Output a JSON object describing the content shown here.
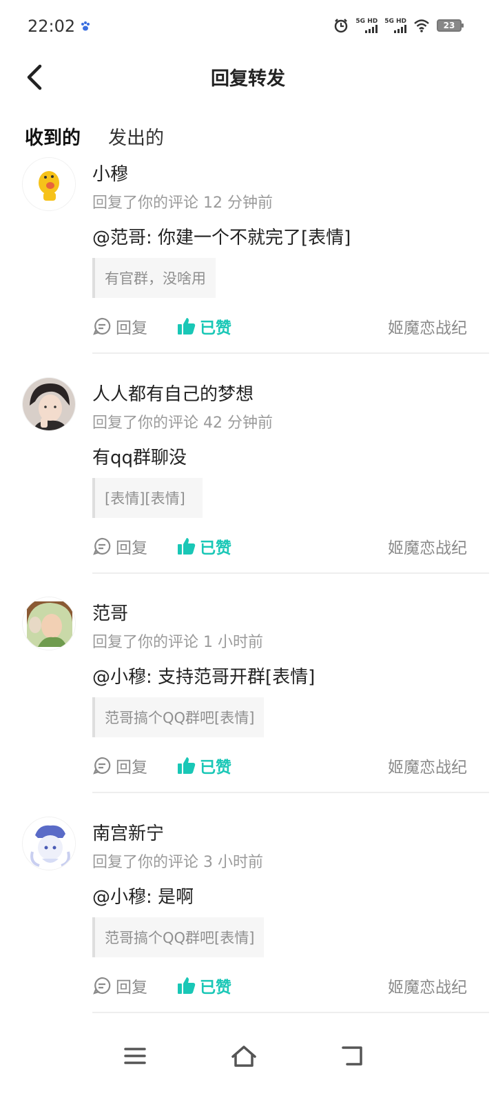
{
  "status_bar": {
    "time": "22:02",
    "sim1_label": "5G HD",
    "sim2_label": "5G HD",
    "battery": "23"
  },
  "header": {
    "title": "回复转发"
  },
  "tabs": [
    {
      "label": "收到的",
      "active": true
    },
    {
      "label": "发出的",
      "active": false
    }
  ],
  "items": [
    {
      "username": "小穆",
      "meta": "回复了你的评论 12 分钟前",
      "reply": "@范哥: 你建一个不就完了[表情]",
      "quote": "有官群，没啥用",
      "reply_label": "回复",
      "like_label": "已赞",
      "source": "姬魔恋战纪"
    },
    {
      "username": "人人都有自己的梦想",
      "meta": "回复了你的评论 42 分钟前",
      "reply": "有qq群聊没",
      "quote": "[表情][表情]",
      "reply_label": "回复",
      "like_label": "已赞",
      "source": "姬魔恋战纪"
    },
    {
      "username": "范哥",
      "meta": "回复了你的评论 1 小时前",
      "reply": "@小穆: 支持范哥开群[表情]",
      "quote": "范哥搞个QQ群吧[表情]",
      "reply_label": "回复",
      "like_label": "已赞",
      "source": "姬魔恋战纪"
    },
    {
      "username": "南宫新宁",
      "meta": "回复了你的评论 3 小时前",
      "reply": "@小穆: 是啊",
      "quote": "范哥搞个QQ群吧[表情]",
      "reply_label": "回复",
      "like_label": "已赞",
      "source": "姬魔恋战纪"
    }
  ],
  "colors": {
    "accent": "#19c7b6",
    "tab_underline": "#34d3c3",
    "secondary_text": "#9a9a9a"
  },
  "icons": {
    "back": "back-arrow-icon",
    "reply": "comment-icon",
    "like": "thumbs-up-icon",
    "nav_menu": "menu-icon",
    "nav_home": "home-icon",
    "nav_back": "back-icon"
  }
}
